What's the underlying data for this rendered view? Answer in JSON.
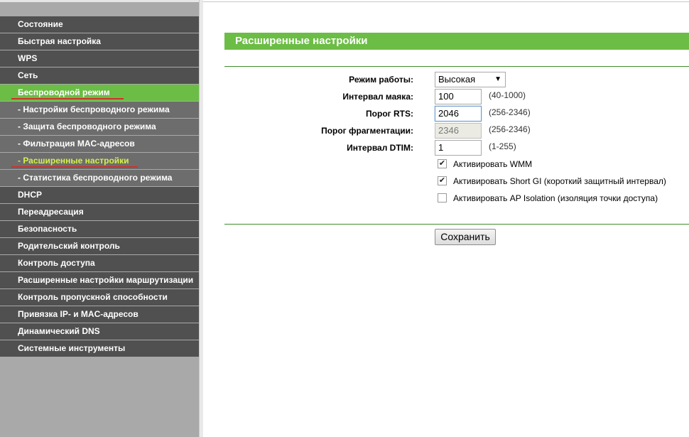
{
  "sidebar": {
    "items": [
      {
        "label": "Состояние"
      },
      {
        "label": "Быстрая настройка"
      },
      {
        "label": "WPS"
      },
      {
        "label": "Сеть"
      },
      {
        "label": "Беспроводной режим"
      },
      {
        "label": "- Настройки беспроводного режима"
      },
      {
        "label": "- Защита беспроводного режима"
      },
      {
        "label": "- Фильтрация MAC-адресов"
      },
      {
        "label": "- Расширенные настройки"
      },
      {
        "label": "- Статистика беспроводного режима"
      },
      {
        "label": "DHCP"
      },
      {
        "label": "Переадресация"
      },
      {
        "label": "Безопасность"
      },
      {
        "label": "Родительский контроль"
      },
      {
        "label": "Контроль доступа"
      },
      {
        "label": "Расширенные настройки маршрутизации"
      },
      {
        "label": "Контроль пропускной способности"
      },
      {
        "label": "Привязка IP- и MAC-адресов"
      },
      {
        "label": "Динамический DNS"
      },
      {
        "label": "Системные инструменты"
      }
    ],
    "active_main_index": 4,
    "active_sub_index": 8,
    "accent_color": "#6bbd45",
    "underline_color": "#d0302a"
  },
  "main": {
    "title": "Расширенные настройки",
    "fields": {
      "mode": {
        "label": "Режим работы:",
        "value": "Высокая"
      },
      "beacon": {
        "label": "Интервал маяка:",
        "value": "100",
        "hint": "(40-1000)"
      },
      "rts": {
        "label": "Порог RTS:",
        "value": "2046",
        "hint": "(256-2346)"
      },
      "frag": {
        "label": "Порог фрагментации:",
        "value": "2346",
        "hint": "(256-2346)"
      },
      "dtim": {
        "label": "Интервал DTIM:",
        "value": "1",
        "hint": "(1-255)"
      }
    },
    "checkboxes": {
      "wmm": {
        "label": "Активировать WMM",
        "checked": true
      },
      "short_gi": {
        "label": "Активировать Short GI (короткий защитный интервал)",
        "checked": true
      },
      "ap_isolation": {
        "label": "Активировать AP Isolation (изоляция точки доступа)",
        "checked": false
      }
    },
    "save_label": "Сохранить"
  }
}
